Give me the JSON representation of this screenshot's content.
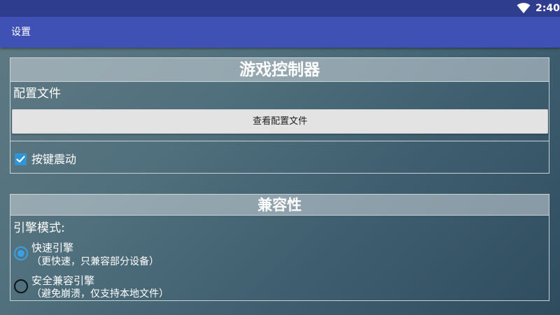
{
  "status_bar": {
    "time": "2:40",
    "wifi_icon": "wifi-icon"
  },
  "app_bar": {
    "title": "设置"
  },
  "controller": {
    "header": "游戏控制器",
    "profile_label": "配置文件",
    "view_profile_button": "查看配置文件",
    "vibration": {
      "label": "按键震动",
      "checked": true
    }
  },
  "compatibility": {
    "header": "兼容性",
    "engine_mode_label": "引擎模式:",
    "options": [
      {
        "title": "快速引擎",
        "description": "（更快速，只兼容部分设备）",
        "selected": true
      },
      {
        "title": "安全兼容引擎",
        "description": "（避免崩溃，仅支持本地文件）",
        "selected": false
      }
    ]
  },
  "colors": {
    "status_bar": "#2f3d8f",
    "app_bar": "#3f51b5",
    "accent": "#3aa0e0",
    "button_bg": "#e3e3e3"
  }
}
